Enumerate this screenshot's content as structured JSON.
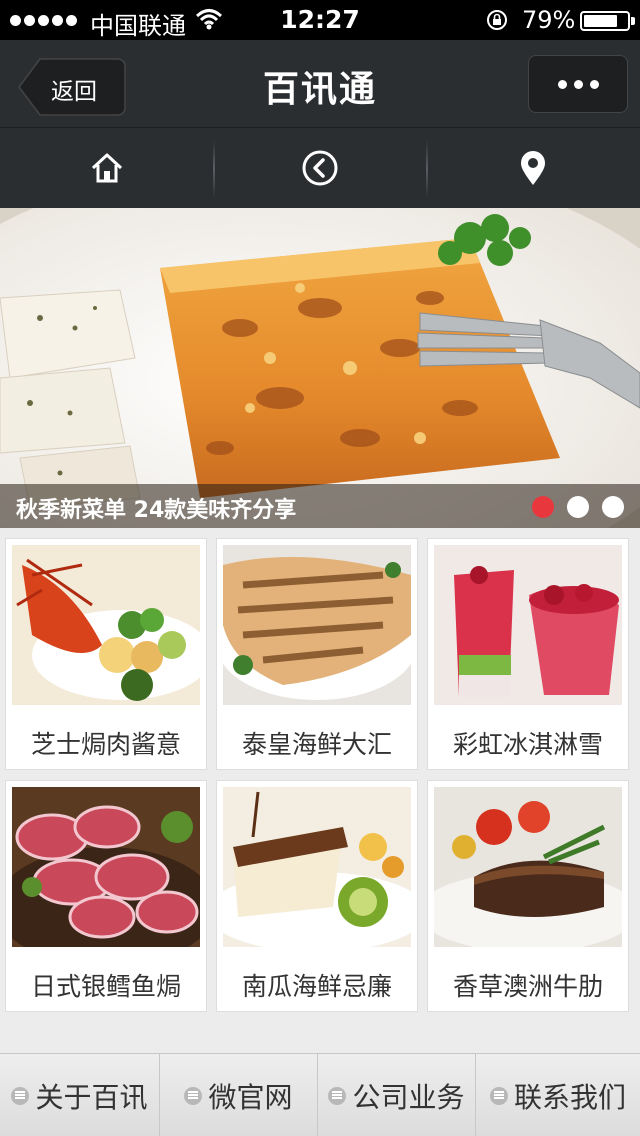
{
  "status_bar": {
    "carrier": "中国联通",
    "time": "12:27",
    "battery": "79%",
    "battery_level": 0.79
  },
  "nav": {
    "back_label": "返回",
    "title": "百讯通",
    "more_icon": "more-icon"
  },
  "toolbar": {
    "icons": [
      "home-icon",
      "back-circle-icon",
      "location-pin-icon"
    ]
  },
  "banner": {
    "caption": "秋季新菜单  24款美味齐分享",
    "slide_count": 3,
    "active_slide": 1,
    "active_dot_color": "#e8383d"
  },
  "menu_items": [
    {
      "label": "芝士焗肉酱意"
    },
    {
      "label": "泰皇海鲜大汇"
    },
    {
      "label": "彩虹冰淇淋雪"
    },
    {
      "label": "日式银鳕鱼焗"
    },
    {
      "label": "南瓜海鲜忌廉"
    },
    {
      "label": "香草澳洲牛肋"
    }
  ],
  "bottom_menu": {
    "items": [
      {
        "label": "关于百讯"
      },
      {
        "label": "微官网"
      },
      {
        "label": "公司业务"
      },
      {
        "label": "联系我们"
      }
    ]
  }
}
